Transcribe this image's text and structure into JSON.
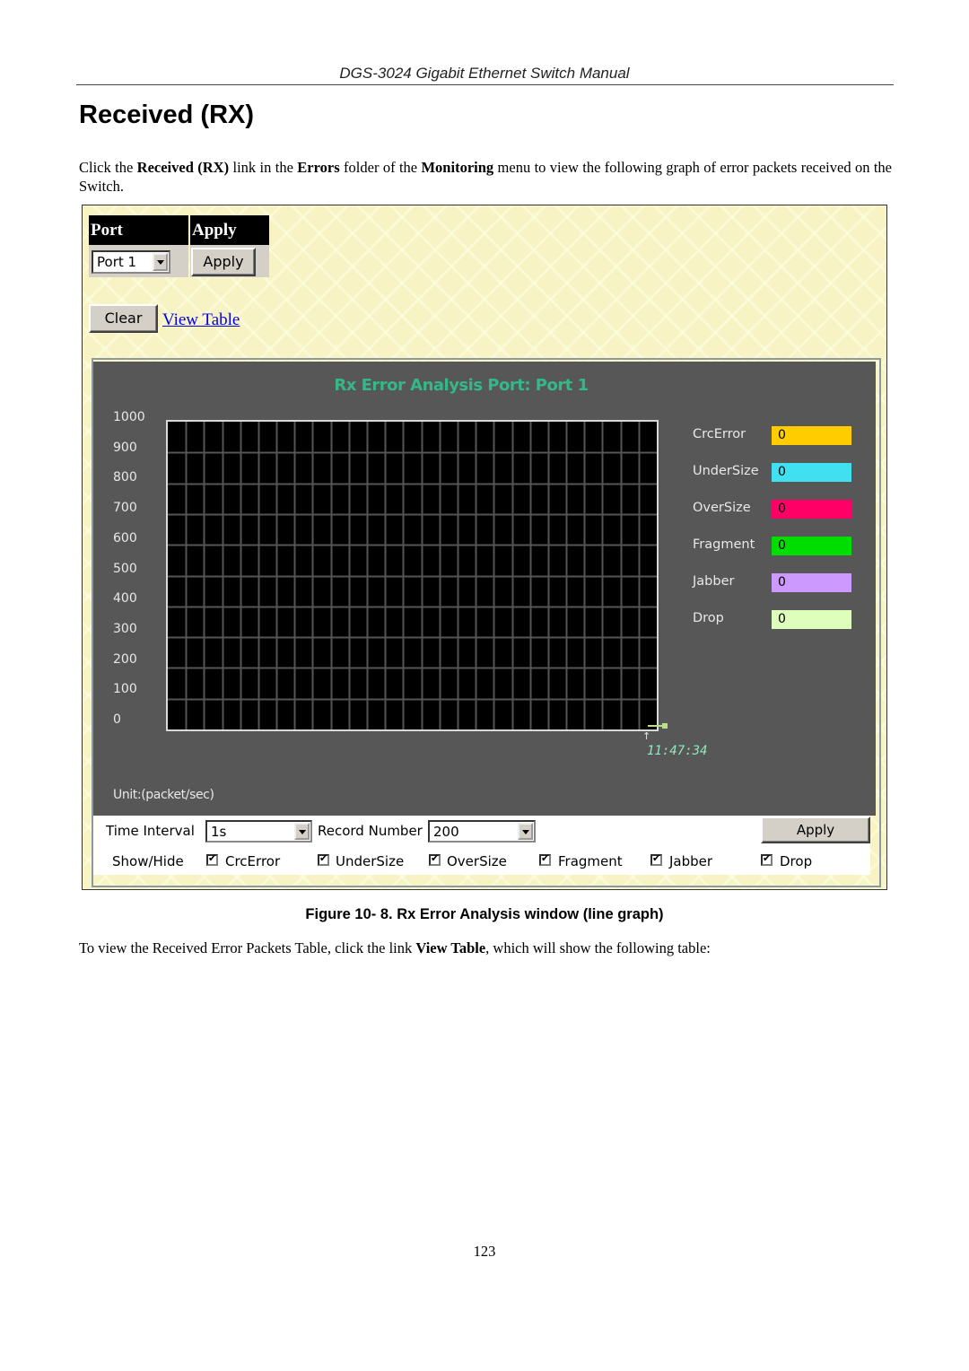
{
  "document": {
    "running_header": "DGS-3024 Gigabit Ethernet Switch Manual",
    "section_title": "Received (RX)",
    "intro": {
      "t1": "Click the ",
      "b1": "Received (RX)",
      "t2": " link in the ",
      "b2": "Errors",
      "t3": " folder of the ",
      "b3": "Monitoring",
      "t4": " menu to view the following graph of error packets received on the Switch."
    },
    "figure_caption": "Figure 10- 8. Rx Error Analysis window (line graph)",
    "after_text": {
      "t1": "To view the Received Error Packets Table, click the link ",
      "b1": "View Table",
      "t2": ", which will show the following table:"
    },
    "page_number": "123"
  },
  "ui": {
    "port_header": "Port",
    "apply_header": "Apply",
    "port_select_value": "Port 1",
    "apply_button": "Apply",
    "clear_button": "Clear",
    "view_table_link": "View Table",
    "graph": {
      "title": "Rx Error Analysis Port: Port 1",
      "time_label": "11:47:34",
      "unit_label": "Unit:(packet/sec)",
      "legend": [
        {
          "label": "CrcError",
          "value": "0",
          "color": "#ffcc00"
        },
        {
          "label": "UnderSize",
          "value": "0",
          "color": "#40e0f0"
        },
        {
          "label": "OverSize",
          "value": "0",
          "color": "#ff0066"
        },
        {
          "label": "Fragment",
          "value": "0",
          "color": "#00dd00"
        },
        {
          "label": "Jabber",
          "value": "0",
          "color": "#cc99ff"
        },
        {
          "label": "Drop",
          "value": "0",
          "color": "#ddffbb"
        }
      ]
    },
    "controls": {
      "time_interval_label": "Time Interval",
      "time_interval_value": "1s",
      "record_number_label": "Record Number",
      "record_number_value": "200",
      "apply_button": "Apply",
      "show_hide_label": "Show/Hide",
      "checkboxes": [
        {
          "label": "CrcError",
          "checked": true
        },
        {
          "label": "UnderSize",
          "checked": true
        },
        {
          "label": "OverSize",
          "checked": true
        },
        {
          "label": "Fragment",
          "checked": true
        },
        {
          "label": "Jabber",
          "checked": true
        },
        {
          "label": "Drop",
          "checked": true
        }
      ]
    }
  },
  "chart_data": {
    "type": "line",
    "title": "Rx Error Analysis Port: Port 1",
    "xlabel": "",
    "ylabel": "Unit:(packet/sec)",
    "ylim": [
      0,
      1000
    ],
    "yticks": [
      "1000",
      "900",
      "800",
      "700",
      "600",
      "500",
      "400",
      "300",
      "200",
      "100",
      "0"
    ],
    "x": [
      "11:47:34"
    ],
    "grid": true,
    "legend_position": "right",
    "series": [
      {
        "name": "CrcError",
        "values": [
          0
        ]
      },
      {
        "name": "UnderSize",
        "values": [
          0
        ]
      },
      {
        "name": "OverSize",
        "values": [
          0
        ]
      },
      {
        "name": "Fragment",
        "values": [
          0
        ]
      },
      {
        "name": "Jabber",
        "values": [
          0
        ]
      },
      {
        "name": "Drop",
        "values": [
          0
        ]
      }
    ]
  }
}
